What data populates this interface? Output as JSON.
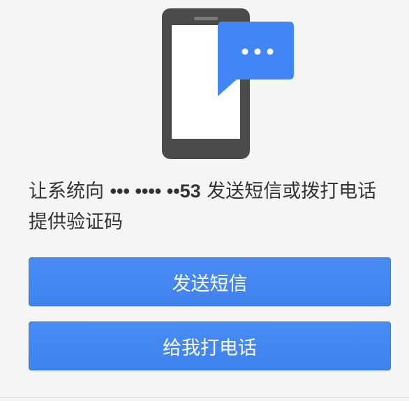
{
  "prompt": {
    "prefix": "让系统向",
    "masked_number": "••• •••• ••53",
    "suffix": "发送短信或拨打电话提供验证码"
  },
  "buttons": {
    "send_sms": "发送短信",
    "call_me": "给我打电话"
  },
  "icons": {
    "illustration": "phone-with-message-icon"
  },
  "colors": {
    "button_blue": "#4285f4",
    "phone_body": "#4a4a4a",
    "bubble_blue": "#4285f4",
    "background": "#f5f5f5"
  }
}
